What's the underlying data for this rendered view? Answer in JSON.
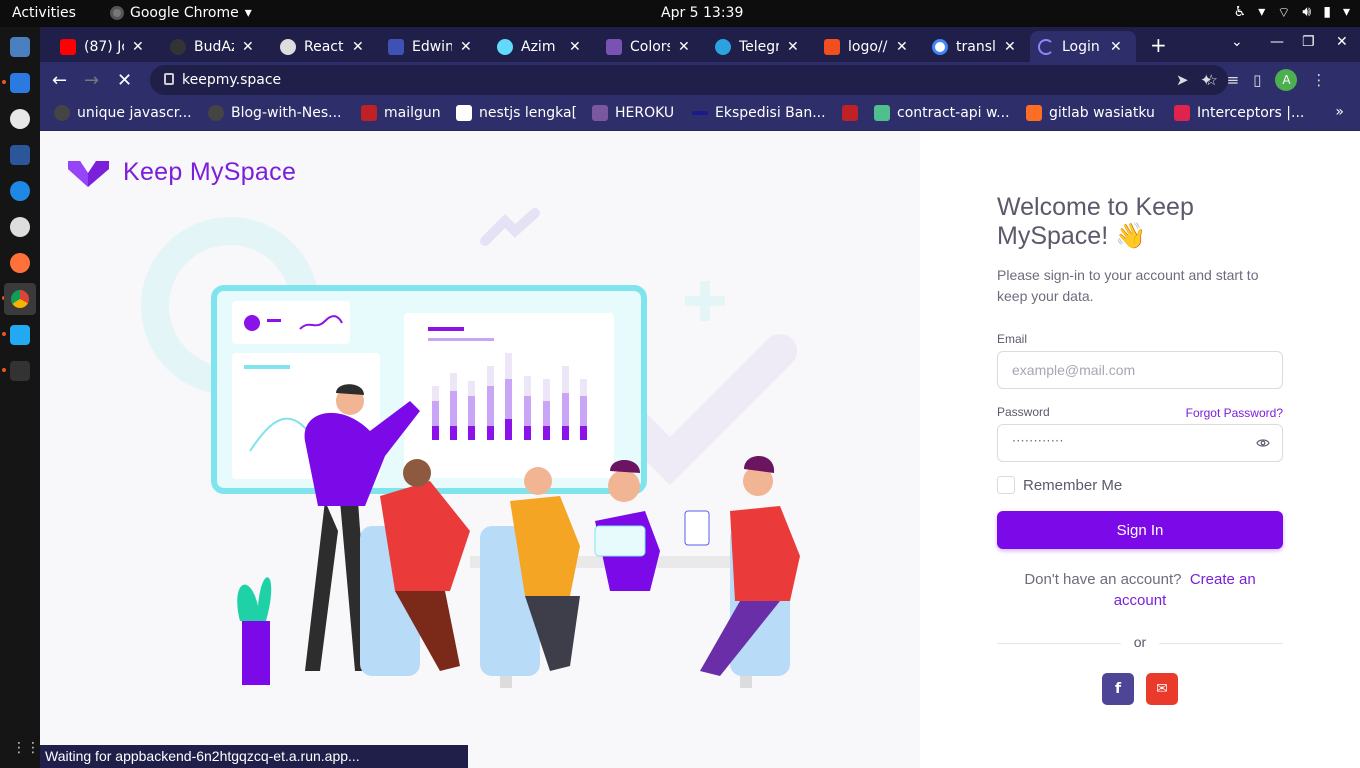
{
  "system": {
    "activities": "Activities",
    "app_name": "Google Chrome",
    "clock": "Apr 5  13:39"
  },
  "tabs": [
    {
      "label": "(87) Jo",
      "icon_color": "#ff0000"
    },
    {
      "label": "BudAz",
      "icon_color": "#333333"
    },
    {
      "label": "React",
      "icon_color": "#dddddd"
    },
    {
      "label": "Edwin",
      "icon_color": "#3f51b5"
    },
    {
      "label": "Azim",
      "icon_color": "#61dafb"
    },
    {
      "label": "Colors",
      "icon_color": "#7952b3"
    },
    {
      "label": "Telegr",
      "icon_color": "#2aa3df"
    },
    {
      "label": "logo//",
      "icon_color": "#f24e1e"
    },
    {
      "label": "transla",
      "icon_color": "#ffffff"
    },
    {
      "label": "Login",
      "icon_color": "#8888ff"
    }
  ],
  "toolbar": {
    "url": "keepmy.space",
    "avatar_letter": "A"
  },
  "bookmarks": [
    {
      "label": "unique javascr...",
      "icon_color": "#444444"
    },
    {
      "label": "Blog-with-Nes...",
      "icon_color": "#444444"
    },
    {
      "label": "mailgun",
      "icon_color": "#c02126"
    },
    {
      "label": "nestjs lengka[",
      "icon_color": "#ffffff"
    },
    {
      "label": "HEROKU",
      "icon_color": "#79589f"
    },
    {
      "label": "Ekspedisi Ban...",
      "icon_color": "#1a1a8c"
    },
    {
      "label": "",
      "icon_color": "#c02126"
    },
    {
      "label": "contract-api w...",
      "icon_color": "#4fc08d"
    },
    {
      "label": "gitlab wasiatku",
      "icon_color": "#fc6d26"
    },
    {
      "label": "Interceptors |...",
      "icon_color": "#e0234e"
    }
  ],
  "brand": {
    "name": "Keep MySpace",
    "color": "#7b1fdb"
  },
  "login": {
    "welcome": "Welcome to Keep MySpace! 👋",
    "subtitle": "Please sign-in to your account and start to keep your data.",
    "email_label": "Email",
    "email_placeholder": "example@mail.com",
    "password_label": "Password",
    "forgot_label": "Forgot Password?",
    "password_value": "············",
    "remember_label": "Remember Me",
    "signin_label": "Sign In",
    "no_account": "Don't have an account?",
    "create_account": "Create an account",
    "or": "or"
  },
  "colors": {
    "primary": "#7b09e8",
    "facebook": "#3b5998",
    "gmail": "#dd4b39",
    "tab_bar": "#1f1f4a"
  },
  "status_text": "Waiting for appbackend-6n2htgqzcq-et.a.run.app..."
}
